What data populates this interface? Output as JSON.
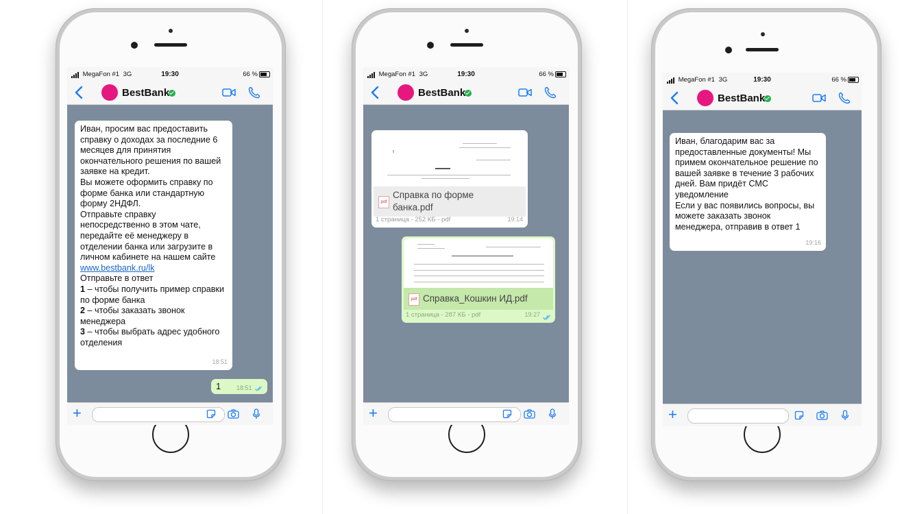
{
  "status_bar": {
    "carrier": "MegaFon #1",
    "network": "3G",
    "time": "19:30",
    "battery": "66 %"
  },
  "chat": {
    "name": "BestBank",
    "brand_color": "#e6177f",
    "verified_color": "#23b04b",
    "accent_color": "#1a7cf5"
  },
  "screen1": {
    "message_in": {
      "text_part1": "Иван, просим вас предоставить справку о доходах за последние 6 месяцев для принятия окончательного решения по вашей заявке на кредит.\nВы можете оформить справку по форме банка или стандартную форму 2НДФЛ.\nОтправьте справку непосредственно в этом чате, передайте её менеджеру в отделении банка или загрузите в личном кабинете на нашем сайте",
      "link": "www.bestbank.ru/lk",
      "reply_intro": "Отправьте в ответ",
      "opt1_num": "1",
      "opt1_text": " – чтобы получить пример справки по форме банка",
      "opt2_num": "2",
      "opt2_text": " – чтобы заказать звонок менеджера",
      "opt3_num": "3",
      "opt3_text": " – чтобы выбрать адрес удобного отделения",
      "time": "18:51"
    },
    "message_out": {
      "text": "1",
      "time": "18:51"
    }
  },
  "screen2": {
    "doc_in": {
      "name": "Справка по форме банка.pdf",
      "info": "1 страница - 252 КБ - pdf",
      "time": "19:14"
    },
    "doc_out": {
      "name": "Справка_Кошкин ИД.pdf",
      "info": "1 страница - 287 КБ - pdf",
      "time": "19:27"
    }
  },
  "screen3": {
    "message_in": {
      "text": "Иван, благодарим вас за предоставленные документы! Мы примем окончательное решение по вашей заявке в течение 3 рабочих дней. Вам придёт СМС уведомление\nЕсли у вас появились вопросы, вы можете заказать звонок менеджера, отправив в ответ 1",
      "time": "19:16"
    }
  },
  "icons": {
    "back": "chevron-left-icon",
    "video": "video-call-icon",
    "call": "phone-call-icon",
    "plus": "plus-icon",
    "sticker": "sticker-icon",
    "camera": "camera-icon",
    "mic": "microphone-icon",
    "pdf": "pdf-file-icon",
    "read": "double-check-icon"
  },
  "pdf_label": "pdf"
}
